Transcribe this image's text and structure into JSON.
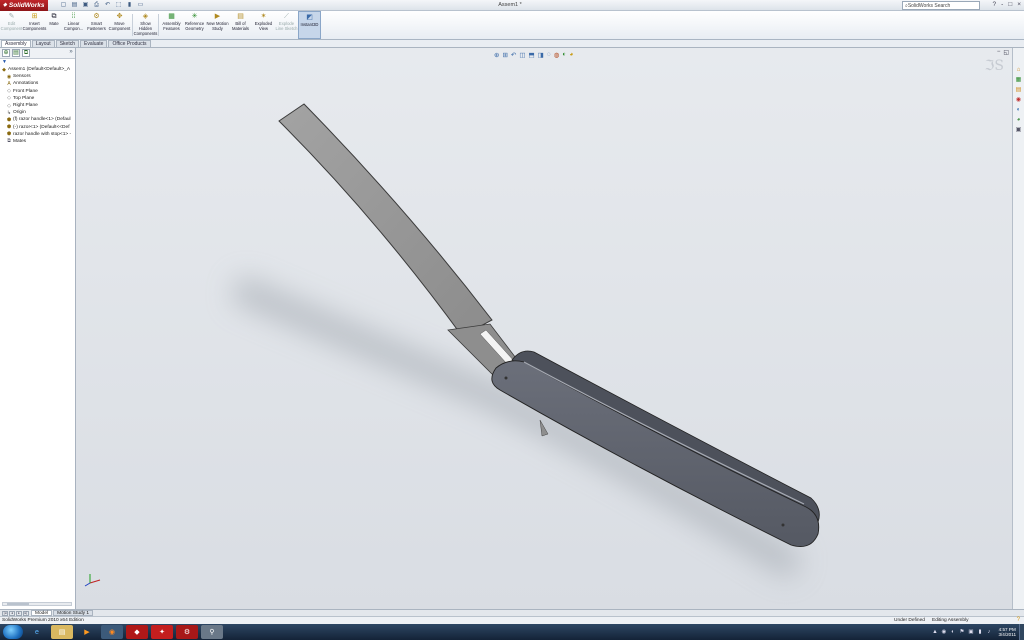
{
  "app": {
    "logo_text": "SolidWorks",
    "window_title": "Assem1 *",
    "search_placeholder": "SolidWorks Search",
    "quick_access": [
      "new-icon",
      "open-icon",
      "save-icon",
      "print-icon",
      "undo-icon",
      "select-icon",
      "rebuild-icon",
      "options-icon"
    ],
    "window_buttons": [
      "?",
      "-",
      "□",
      "×"
    ]
  },
  "commands": [
    {
      "label": "Edit Component",
      "icon": "edit-component-icon",
      "disabled": true
    },
    {
      "label": "Insert Components",
      "icon": "insert-components-icon"
    },
    {
      "label": "Mate",
      "icon": "mate-icon"
    },
    {
      "label": "Linear Compon...",
      "icon": "linear-pattern-icon"
    },
    {
      "label": "Smart Fasteners",
      "icon": "smart-fasteners-icon"
    },
    {
      "label": "Move Component",
      "icon": "move-component-icon"
    },
    {
      "label": "Show Hidden Components",
      "icon": "show-hidden-icon"
    },
    {
      "label": "Assembly Features",
      "icon": "assembly-features-icon"
    },
    {
      "label": "Reference Geometry",
      "icon": "reference-geometry-icon"
    },
    {
      "label": "New Motion Study",
      "icon": "motion-study-icon"
    },
    {
      "label": "Bill of Materials",
      "icon": "bom-icon"
    },
    {
      "label": "Exploded View",
      "icon": "exploded-view-icon"
    },
    {
      "label": "Explode Line Sketch",
      "icon": "explode-line-icon",
      "disabled": true
    },
    {
      "label": "Instant3D",
      "icon": "instant3d-icon",
      "active": true
    }
  ],
  "tabs": [
    "Assembly",
    "Layout",
    "Sketch",
    "Evaluate",
    "Office Products"
  ],
  "selected_tab": "Assembly",
  "tree": {
    "filter": "▼",
    "nodes": [
      {
        "label": "Assem1  (Default<Default>_A",
        "icon": "assembly-icon",
        "level": 0
      },
      {
        "label": "Sensors",
        "icon": "sensors-icon",
        "level": 1
      },
      {
        "label": "Annotations",
        "icon": "annotations-icon",
        "level": 1
      },
      {
        "label": "Front Plane",
        "icon": "plane-icon",
        "level": 1
      },
      {
        "label": "Top Plane",
        "icon": "plane-icon",
        "level": 1
      },
      {
        "label": "Right Plane",
        "icon": "plane-icon",
        "level": 1
      },
      {
        "label": "Origin",
        "icon": "origin-icon",
        "level": 1
      },
      {
        "label": "(f) razor handle<1> (Defaul",
        "icon": "part-icon",
        "level": 1
      },
      {
        "label": "(-) razor<1> (Default<<Def",
        "icon": "part-icon",
        "level": 1
      },
      {
        "label": "razor handle with stop<1> -",
        "icon": "part-icon",
        "level": 1
      },
      {
        "label": "Mates",
        "icon": "mates-icon",
        "level": 1
      }
    ]
  },
  "bottom_tabs": [
    "Model",
    "Motion Study 1"
  ],
  "selected_bottom_tab": "Model",
  "status": {
    "left": "SolidWorks Premium 2010 x64 Edition",
    "state": "Under Defined",
    "mode": "Editing Assembly"
  },
  "taskbar": {
    "apps": [
      "ie-icon",
      "explorer-icon",
      "media-player-icon",
      "firefox-icon",
      "autodesk-icon",
      "acrobat-icon",
      "solidworks-icon",
      "misc-icon"
    ],
    "time": "4:57 PM",
    "date": "3/4/2011"
  }
}
